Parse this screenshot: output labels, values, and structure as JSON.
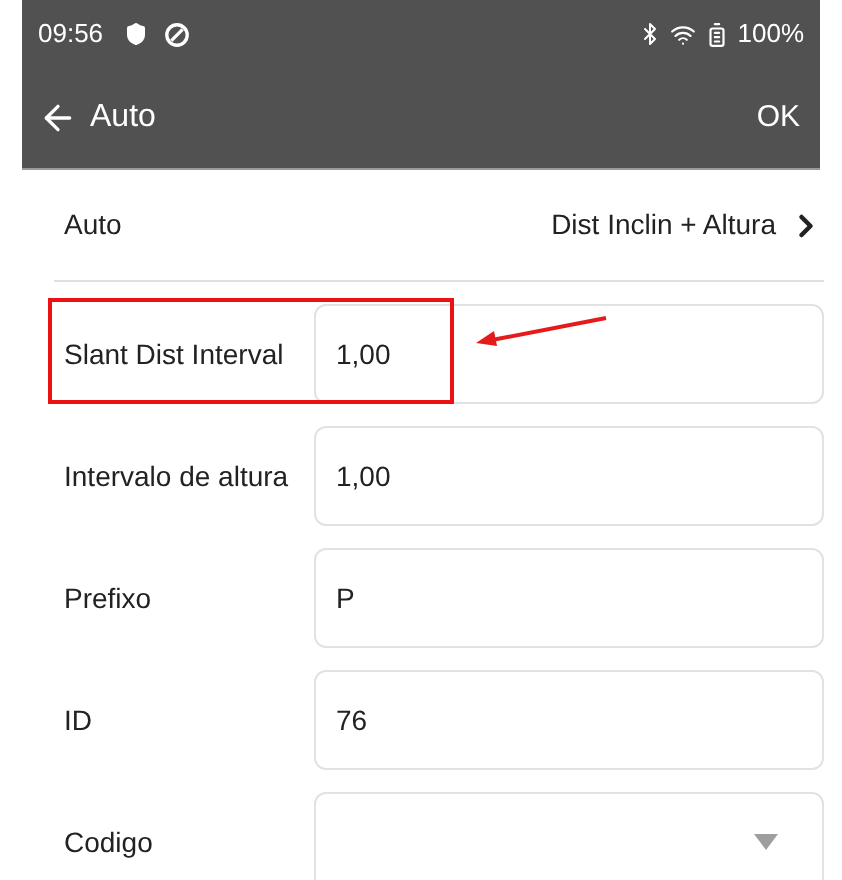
{
  "status_bar": {
    "time": "09:56",
    "battery": "100%"
  },
  "toolbar": {
    "title": "Auto",
    "action": "OK"
  },
  "mode_row": {
    "label": "Auto",
    "value": "Dist Inclin + Altura"
  },
  "fields": [
    {
      "kind": "text",
      "label": "Slant Dist Interval",
      "value": "1,00",
      "highlighted": true
    },
    {
      "kind": "text",
      "label": "Intervalo de altura",
      "value": "1,00",
      "highlighted": false
    },
    {
      "kind": "text",
      "label": "Prefixo",
      "value": "P",
      "highlighted": false
    },
    {
      "kind": "text",
      "label": "ID",
      "value": "76",
      "highlighted": false
    },
    {
      "kind": "select",
      "label": "Codigo",
      "highlighted": false
    }
  ]
}
